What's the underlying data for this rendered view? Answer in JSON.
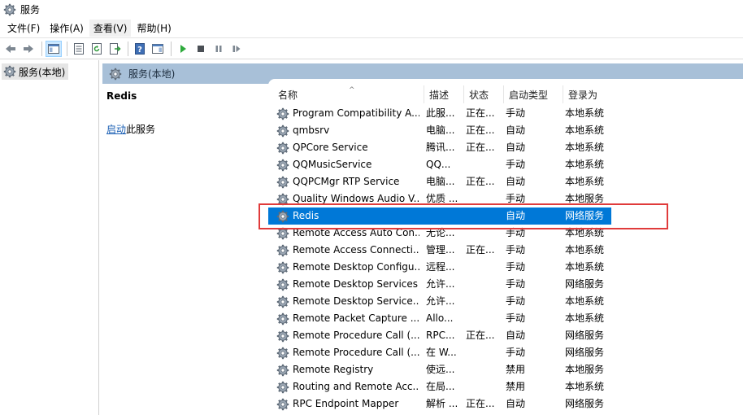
{
  "window": {
    "title": "服务",
    "icon": "services-gear-icon"
  },
  "menu": [
    {
      "label": "文件(F)",
      "active": false
    },
    {
      "label": "操作(A)",
      "active": false
    },
    {
      "label": "查看(V)",
      "active": true
    },
    {
      "label": "帮助(H)",
      "active": false
    }
  ],
  "toolbar": {
    "buttons": [
      "back-arrow-icon",
      "forward-arrow-icon",
      "show-hide-console-tree-icon",
      "properties-icon",
      "refresh-icon",
      "export-list-icon",
      "help-icon",
      "show-hide-action-pane-icon",
      "start-service-icon",
      "stop-service-icon",
      "pause-service-icon",
      "resume-service-icon"
    ]
  },
  "tree": {
    "root_label": "服务(本地)"
  },
  "pane": {
    "header": "服务(本地)",
    "selected_service": "Redis",
    "start_link": "启动",
    "start_suffix": "此服务"
  },
  "columns": {
    "name": "名称",
    "desc": "描述",
    "status": "状态",
    "startup": "启动类型",
    "logon": "登录为"
  },
  "services": [
    {
      "name": "Program Compatibility A...",
      "desc": "此服...",
      "status": "正在...",
      "startup": "手动",
      "logon": "本地系统"
    },
    {
      "name": "qmbsrv",
      "desc": "电脑...",
      "status": "正在...",
      "startup": "自动",
      "logon": "本地系统"
    },
    {
      "name": "QPCore Service",
      "desc": "腾讯...",
      "status": "正在...",
      "startup": "自动",
      "logon": "本地系统"
    },
    {
      "name": "QQMusicService",
      "desc": "QQ...",
      "status": "",
      "startup": "手动",
      "logon": "本地系统"
    },
    {
      "name": "QQPCMgr RTP Service",
      "desc": "电脑...",
      "status": "正在...",
      "startup": "自动",
      "logon": "本地系统"
    },
    {
      "name": "Quality Windows Audio V...",
      "desc": "优质 ...",
      "status": "",
      "startup": "手动",
      "logon": "本地服务"
    },
    {
      "name": "Redis",
      "desc": "",
      "status": "",
      "startup": "自动",
      "logon": "网络服务",
      "selected": true
    },
    {
      "name": "Remote Access Auto Con...",
      "desc": "无论...",
      "status": "",
      "startup": "手动",
      "logon": "本地系统"
    },
    {
      "name": "Remote Access Connecti...",
      "desc": "管理...",
      "status": "正在...",
      "startup": "手动",
      "logon": "本地系统"
    },
    {
      "name": "Remote Desktop Configu...",
      "desc": "远程...",
      "status": "",
      "startup": "手动",
      "logon": "本地系统"
    },
    {
      "name": "Remote Desktop Services",
      "desc": "允许...",
      "status": "",
      "startup": "手动",
      "logon": "网络服务"
    },
    {
      "name": "Remote Desktop Service...",
      "desc": "允许...",
      "status": "",
      "startup": "手动",
      "logon": "本地系统"
    },
    {
      "name": "Remote Packet Capture ...",
      "desc": "Allo...",
      "status": "",
      "startup": "手动",
      "logon": "本地系统"
    },
    {
      "name": "Remote Procedure Call (...",
      "desc": "RPC...",
      "status": "正在...",
      "startup": "自动",
      "logon": "网络服务"
    },
    {
      "name": "Remote Procedure Call (...",
      "desc": "在 W...",
      "status": "",
      "startup": "手动",
      "logon": "网络服务"
    },
    {
      "name": "Remote Registry",
      "desc": "使远...",
      "status": "",
      "startup": "禁用",
      "logon": "本地服务"
    },
    {
      "name": "Routing and Remote Acc...",
      "desc": "在局...",
      "status": "",
      "startup": "禁用",
      "logon": "本地系统"
    },
    {
      "name": "RPC Endpoint Mapper",
      "desc": "解析 ...",
      "status": "正在...",
      "startup": "自动",
      "logon": "网络服务"
    }
  ],
  "colors": {
    "header_band": "#a8c0d8",
    "selection": "#0078d7",
    "highlight_box": "#e03b3b"
  }
}
